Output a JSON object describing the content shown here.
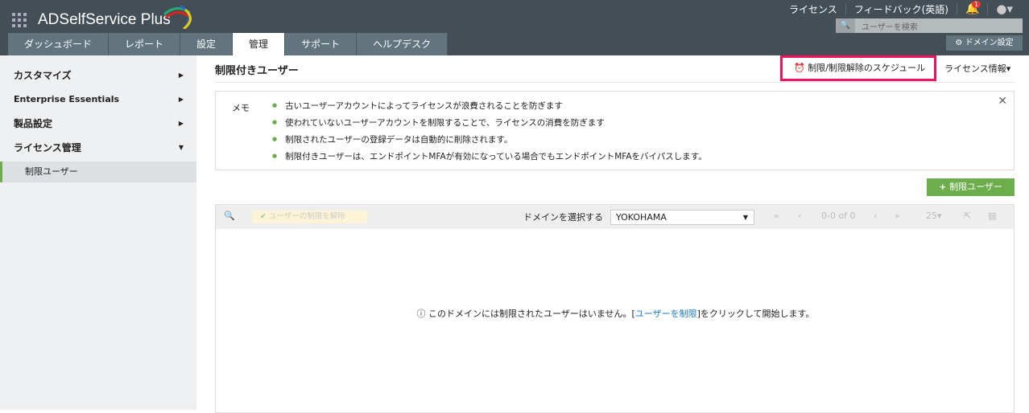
{
  "app": {
    "title": "ADSelfService Plus"
  },
  "tabs": [
    "ダッシュボード",
    "レポート",
    "設定",
    "管理",
    "サポート",
    "ヘルプデスク"
  ],
  "active_tab": "管理",
  "top_links": {
    "license": "ライセンス",
    "feedback": "フィードバック(英語)",
    "notification_count": "1"
  },
  "search": {
    "placeholder": "ユーザーを検索"
  },
  "domain_settings": "ドメイン設定",
  "sidebar": {
    "items": [
      {
        "label": "カスタマイズ"
      },
      {
        "label": "Enterprise Essentials"
      },
      {
        "label": "製品設定"
      },
      {
        "label": "ライセンス管理"
      }
    ],
    "sub": "制限ユーザー"
  },
  "main": {
    "title": "制限付きユーザー",
    "schedule": "制限/制限解除のスケジュール",
    "license_info": "ライセンス情報",
    "memo_label": "メモ",
    "memo": [
      "古いユーザーアカウントによってライセンスが浪費されることを防ぎます",
      "使われていないユーザーアカウントを制限することで、ライセンスの消費を防ぎます",
      "制限されたユーザーの登録データは自動的に削除されます。",
      "制限付きユーザーは、エンドポイントMFAが有効になっている場合でもエンドポイントMFAをバイパスします。"
    ],
    "add_button": "制限ユーザー",
    "unrestrict": "ユーザーの制限を解除",
    "domain_label": "ドメインを選択する",
    "domain_value": "YOKOHAMA",
    "pager": "0-0 of 0",
    "page_size": "25",
    "empty_pre": "このドメインには制限されたユーザーはいません。[",
    "empty_link": "ユーザーを制限",
    "empty_post": "]をクリックして開始します。"
  }
}
